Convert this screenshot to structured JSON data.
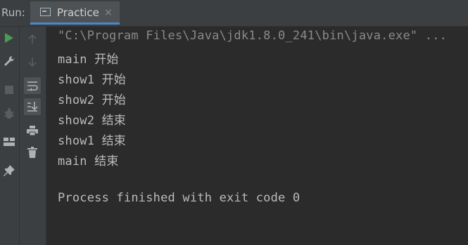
{
  "header": {
    "run_label": "Run:",
    "tab": {
      "label": "Practice",
      "icon": "console-window-icon",
      "close": "×"
    }
  },
  "toolbar_left": [
    {
      "name": "run-icon",
      "color": "#499c54"
    },
    {
      "name": "wrench-icon"
    },
    {
      "name": "stop-icon"
    },
    {
      "name": "debug-bug-icon"
    },
    {
      "name": "layout-icon"
    },
    {
      "name": "pin-icon"
    }
  ],
  "toolbar_right": [
    {
      "name": "arrow-up-icon"
    },
    {
      "name": "arrow-down-icon"
    },
    {
      "name": "soft-wrap-icon"
    },
    {
      "name": "scroll-to-end-icon"
    },
    {
      "name": "print-icon"
    },
    {
      "name": "trash-icon"
    }
  ],
  "console": {
    "lines": [
      "\"C:\\Program Files\\Java\\jdk1.8.0_241\\bin\\java.exe\" ...",
      "main 开始",
      "show1 开始",
      "show2 开始",
      "show2 结束",
      "show1 结束",
      "main 结束",
      "",
      "Process finished with exit code 0"
    ]
  },
  "colors": {
    "background": "#2b2b2b",
    "panel": "#3c3f41",
    "text": "#bbbbbb",
    "tab_underline": "#4a88c7",
    "run_green": "#499c54"
  }
}
